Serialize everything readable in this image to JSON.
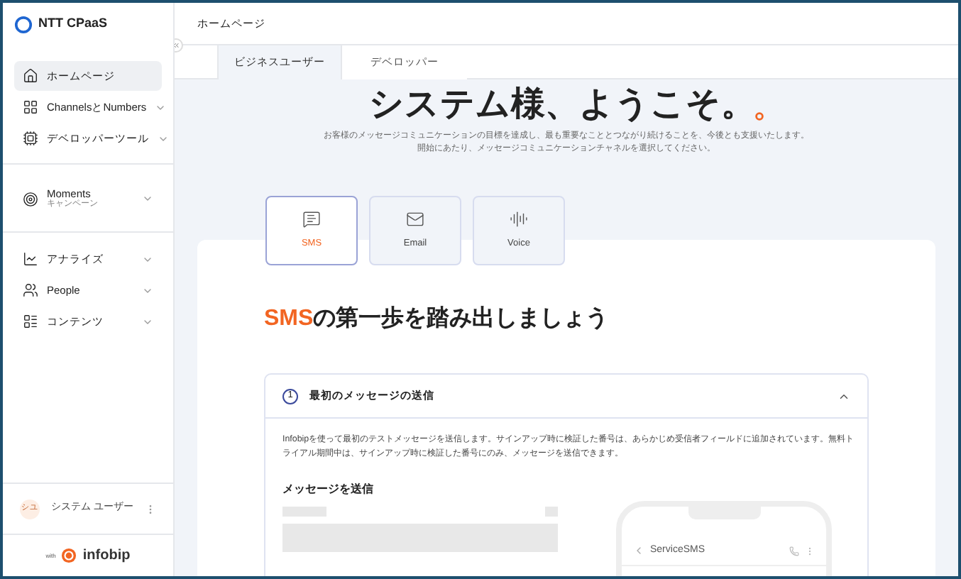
{
  "sidebar": {
    "logo": "NTT CPaaS",
    "groups": [
      [
        {
          "label": "ホームページ",
          "selected": true,
          "expandable": false
        },
        {
          "label": "ChannelsとNumbers",
          "selected": false,
          "expandable": true
        },
        {
          "label": "デベロッパーツール",
          "selected": false,
          "expandable": true
        }
      ],
      [
        {
          "label": "Moments",
          "sublabel": "キャンペーン",
          "selected": false,
          "expandable": true
        }
      ],
      [
        {
          "label": "アナライズ",
          "selected": false,
          "expandable": true
        },
        {
          "label": "People",
          "selected": false,
          "expandable": true
        },
        {
          "label": "コンテンツ",
          "selected": false,
          "expandable": true
        }
      ]
    ],
    "user": {
      "initials": "シユ",
      "name": "システム ユーザー"
    },
    "footer": {
      "with": "with",
      "brand": "infobip"
    }
  },
  "header": {
    "title": "ホームページ"
  },
  "tabs": [
    {
      "label": "ビジネスユーザー",
      "selected": true
    },
    {
      "label": "デベロッパー",
      "selected": false
    }
  ],
  "welcome": {
    "title": "システム様、ようこそ。",
    "lines": [
      "お客様のメッセージコミュニケーションの目標を達成し、最も重要なこととつながり続けることを、今後とも支援いたします。",
      "開始にあたり、メッセージコミュニケーションチャネルを選択してください。"
    ]
  },
  "channels": [
    {
      "label": "SMS",
      "selected": true
    },
    {
      "label": "Email",
      "selected": false
    },
    {
      "label": "Voice",
      "selected": false
    }
  ],
  "section": {
    "highlight": "SMS",
    "title": "の第一歩を踏み出しましょう",
    "step": {
      "number": "1",
      "title": "最初のメッセージの送信",
      "expanded": true,
      "description": "Infobipを使って最初のテストメッセージを送信します。サインアップ時に検証した番号は、あらかじめ受信者フィールドに追加されています。無料トライアル期間中は、サインアップ時に検証した番号にのみ、メッセージを送信できます。",
      "form_title": "メッセージを送信",
      "phone_sender": "ServiceSMS"
    }
  }
}
